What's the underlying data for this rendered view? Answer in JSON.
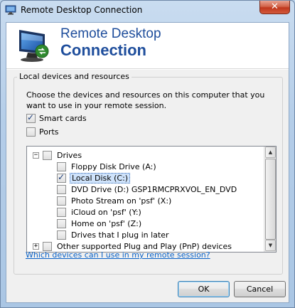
{
  "window": {
    "title": "Remote Desktop Connection",
    "close_label": "✕"
  },
  "banner": {
    "line1": "Remote Desktop",
    "line2": "Connection"
  },
  "group": {
    "title": "Local devices and resources",
    "description": "Choose the devices and resources on this computer that you want to use in your remote session."
  },
  "options": {
    "smart_cards": {
      "label": "Smart cards",
      "checked": true
    },
    "ports": {
      "label": "Ports",
      "checked": false
    }
  },
  "tree": {
    "drives": {
      "label": "Drives",
      "expander": "−",
      "checked": false
    },
    "items": [
      {
        "label": "Floppy Disk Drive (A:)",
        "checked": false
      },
      {
        "label": "Local Disk (C:)",
        "checked": true
      },
      {
        "label": "DVD Drive (D:) GSP1RMCPRXVOL_EN_DVD",
        "checked": false
      },
      {
        "label": "Photo Stream on 'psf' (X:)",
        "checked": false
      },
      {
        "label": "iCloud on 'psf' (Y:)",
        "checked": false
      },
      {
        "label": "Home on 'psf' (Z:)",
        "checked": false
      },
      {
        "label": "Drives that I plug in later",
        "checked": false
      }
    ],
    "pnp": {
      "label": "Other supported Plug and Play (PnP) devices",
      "expander": "+",
      "checked": false
    },
    "scroll_up": "▲",
    "scroll_down": "▼"
  },
  "help_link": "Which devices can I use in my remote session?",
  "buttons": {
    "ok": "OK",
    "cancel": "Cancel"
  },
  "colors": {
    "accent": "#1f4e9c",
    "link": "#0a62c8",
    "close": "#c0381d"
  }
}
